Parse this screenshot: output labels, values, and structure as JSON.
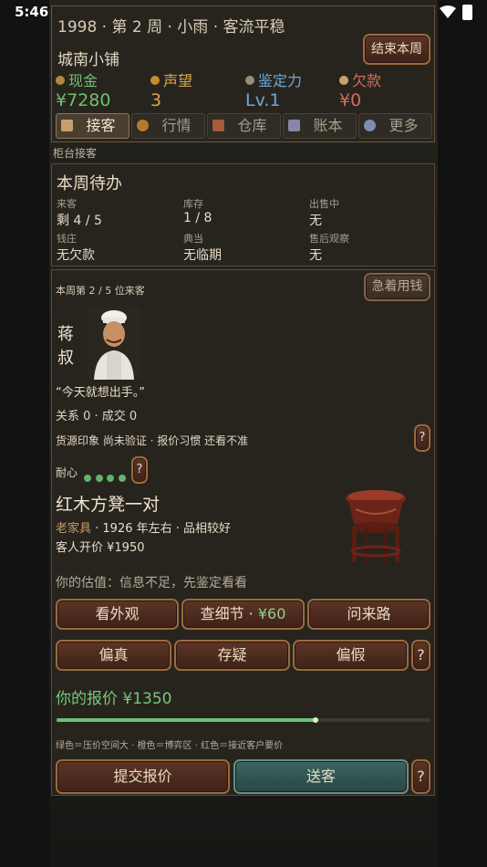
{
  "status_bar": {
    "time": "5:46",
    "notif": "A"
  },
  "header": {
    "title": "1998 · 第 2 周 · 小雨 · 客流平稳",
    "shop_name": "城南小铺",
    "end_week_label": "结束本周",
    "stats": [
      {
        "label": "现金",
        "value": "¥7280",
        "color": "#6cc070",
        "icon_color": "#b08a3a",
        "icon": "coin-icon"
      },
      {
        "label": "声望",
        "value": "3",
        "color": "#d8a94a",
        "icon_color": "#c88a2e",
        "icon": "reputation-icon"
      },
      {
        "label": "鉴定力",
        "value": "Lv.1",
        "color": "#6ea6d6",
        "icon_color": "#9a8d76",
        "icon": "appraisal-icon"
      },
      {
        "label": "欠款",
        "value": "¥0",
        "color": "#d06d5c",
        "icon_color": "#c9a46a",
        "icon": "debt-icon"
      }
    ]
  },
  "tabs": [
    {
      "label": "接客",
      "icon": "customer-icon",
      "active": true
    },
    {
      "label": "行情",
      "icon": "market-icon",
      "active": false
    },
    {
      "label": "仓库",
      "icon": "storage-icon",
      "active": false
    },
    {
      "label": "账本",
      "icon": "ledger-icon",
      "active": false
    },
    {
      "label": "更多",
      "icon": "gear-icon",
      "active": false
    }
  ],
  "section_label": "柜台接客",
  "todo": {
    "title": "本周待办",
    "items": [
      {
        "key": "来客",
        "value": "剩 4 / 5"
      },
      {
        "key": "库存",
        "value": "1 / 8"
      },
      {
        "key": "出售中",
        "value": "无"
      },
      {
        "key": "钱庄",
        "value": "无欠款"
      },
      {
        "key": "典当",
        "value": "无临期"
      },
      {
        "key": "售后观察",
        "value": "无"
      }
    ]
  },
  "customer": {
    "counter": "本周第 2 / 5 位来客",
    "urgent_label": "急着用钱",
    "name_line1": "蒋",
    "name_line2": "叔",
    "quote": "“今天就想出手。”",
    "relation": "关系 0 · 成交 0",
    "impression": "货源印象 尚未验证 · 报价习惯 还看不准",
    "patience_label": "耐心",
    "patience_dots": 4,
    "help_label": "?"
  },
  "item": {
    "name": "红木方凳一对",
    "category": "老家具",
    "meta": " · 1926 年左右 · 品相较好",
    "asking": "客人开价 ¥1950",
    "estimate": "你的估值：信息不足，先鉴定看看"
  },
  "actions": {
    "look": "看外观",
    "detail": "查细节 · ",
    "detail_cost": "¥60",
    "origin": "问来路",
    "genuine": "偏真",
    "doubt": "存疑",
    "fake": "偏假"
  },
  "offer": {
    "label": "你的报价 ¥1350",
    "slider_fraction": 0.692,
    "legend": "绿色＝压价空间大 · 橙色＝博弈区 · 红色＝接近客户要价",
    "submit": "提交报价",
    "send_off": "送客"
  }
}
